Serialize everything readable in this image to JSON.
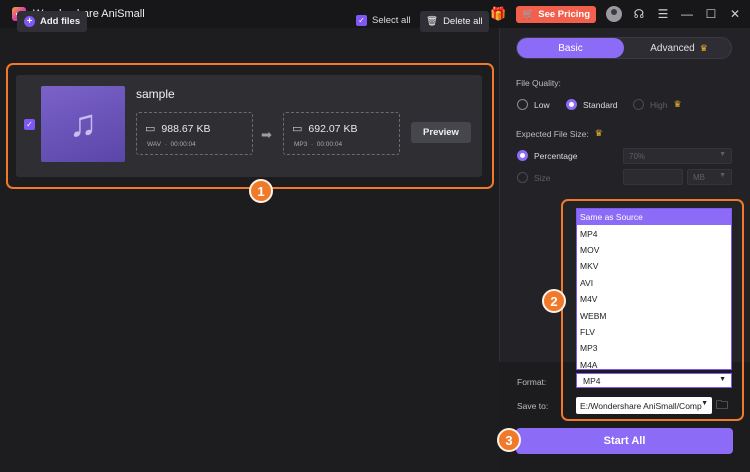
{
  "titlebar": {
    "app_title": "Wondershare AniSmall",
    "see_pricing": "See Pricing",
    "accent": "#f25f4c",
    "icons": [
      "gift-icon",
      "avatar",
      "headset-icon",
      "menu-icon",
      "minimize-icon",
      "maximize-icon",
      "close-icon"
    ]
  },
  "toolbar": {
    "add_files": "Add files",
    "select_all": "Select all",
    "delete_all": "Delete all"
  },
  "file": {
    "name": "sample",
    "source": {
      "size": "988.67 KB",
      "format": "WAV",
      "duration": "00:00:04"
    },
    "output": {
      "size": "692.07 KB",
      "format": "MP3",
      "duration": "00:00:04"
    },
    "preview": "Preview",
    "checked": true
  },
  "settings": {
    "tabs": {
      "basic": "Basic",
      "advanced": "Advanced",
      "active": "Basic"
    },
    "file_quality_label": "File Quality:",
    "quality": {
      "low": "Low",
      "standard": "Standard",
      "high": "High",
      "selected": "Standard"
    },
    "expected_size_label": "Expected File Size:",
    "percentage_label": "Percentage",
    "percentage_value": "70%",
    "size_label": "Size",
    "size_unit": "MB"
  },
  "format": {
    "label": "Format:",
    "value": "MP4",
    "options": [
      "Same as Source",
      "MP4",
      "MOV",
      "MKV",
      "AVI",
      "M4V",
      "WEBM",
      "FLV",
      "MP3",
      "M4A"
    ],
    "highlighted": "Same as Source"
  },
  "save_to": {
    "label": "Save to:",
    "value": "E:/Wondershare AniSmall/Comp"
  },
  "start_all": "Start All",
  "callouts": [
    "1",
    "2",
    "3"
  ],
  "colors": {
    "accent_purple": "#8c6bf7",
    "callout_orange": "#f07a2a",
    "background": "#1d1d20"
  }
}
